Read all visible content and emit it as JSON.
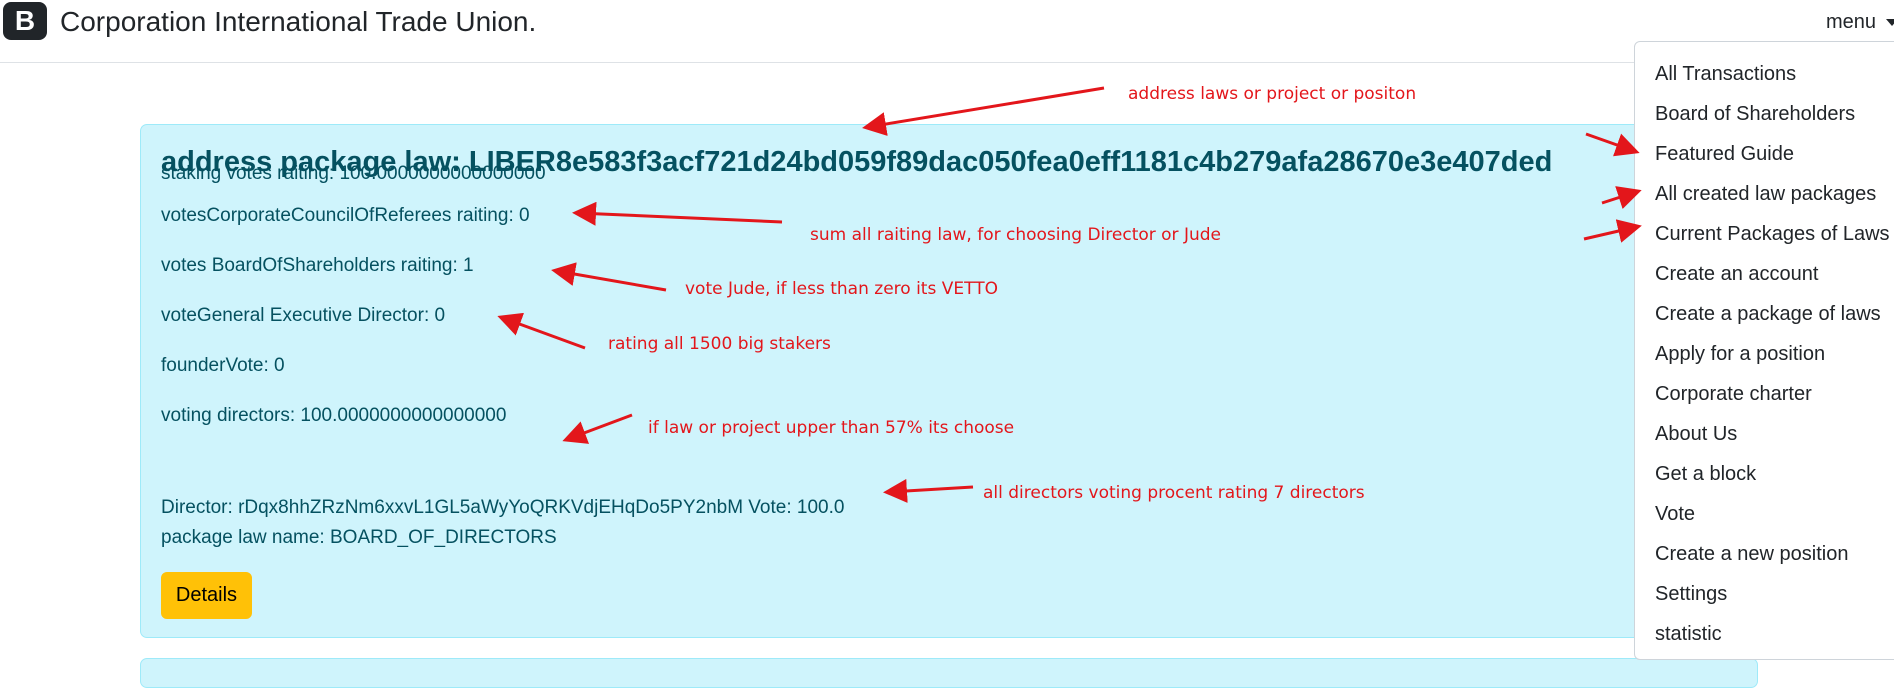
{
  "navbar": {
    "logo_letter": "B",
    "title": "Corporation International Trade Union.",
    "menu_label": "menu"
  },
  "menu": {
    "items": [
      "All Transactions",
      "Board of Shareholders",
      "Featured Guide",
      "All created law packages",
      "Current Packages of Laws",
      "Create an account",
      "Create a package of laws",
      "Apply for a position",
      "Corporate charter",
      "About Us",
      "Get a block",
      "Vote",
      "Create a new position",
      "Settings",
      "statistic"
    ]
  },
  "card": {
    "title": "address package law: LIBER8e583f3acf721d24bd059f89dac050fea0eff1181c4b279afa28670e3e407ded",
    "staking": "staking votes raiting: 100.0000000000000000",
    "council": "votesCorporateCouncilOfReferees raiting: 0",
    "board": "votes BoardOfShareholders raiting: 1",
    "general": "voteGeneral Executive Director: 0",
    "founder": "founderVote: 0",
    "directors": "voting directors: 100.0000000000000000",
    "director_line": "Director: rDqx8hhZRzNm6xxvL1GL5aWyYoQRKVdjEHqDo5PY2nbM Vote: 100.0",
    "package_name": "package law name: BOARD_OF_DIRECTORS",
    "details_label": "Details"
  },
  "annotations": {
    "address": "address laws or project or positon",
    "sum": "sum all raiting law, for choosing Director or Jude",
    "jude": "vote Jude, if less than zero its VETTO",
    "rating": "rating all 1500 big stakers",
    "law": "if law or project upper than 57% its choose",
    "directors": "all directors voting procent rating 7 directors"
  },
  "colors": {
    "card_bg": "#cff4fc",
    "card_text": "#055160",
    "button": "#ffc107",
    "annotation": "#e3161b"
  }
}
